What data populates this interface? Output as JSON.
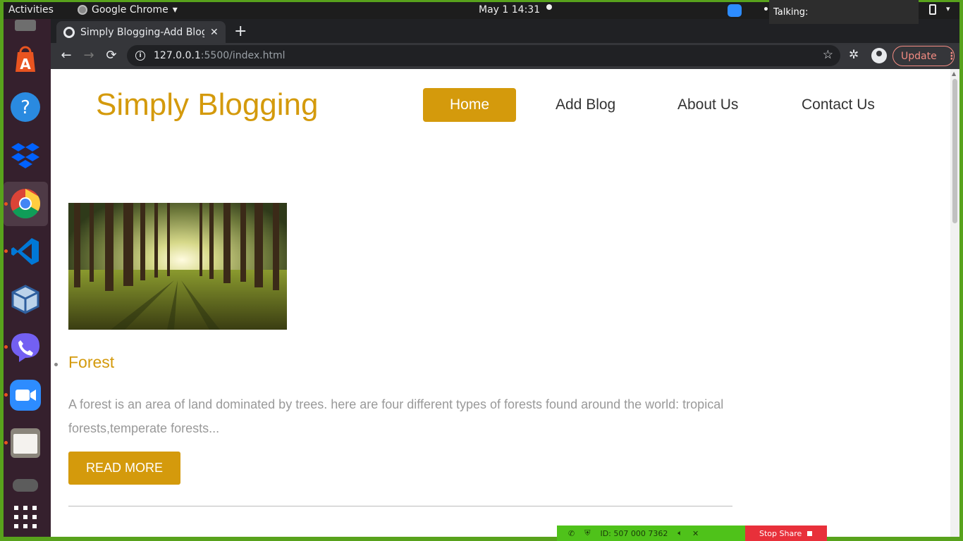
{
  "topbar": {
    "activities": "Activities",
    "app_menu": "Google Chrome",
    "app_menu_caret": "▾",
    "clock": "May 1  14:31",
    "tray_overflow": "•••",
    "talking_label": "Talking:",
    "system_caret": "▾"
  },
  "dock": {
    "items": [
      {
        "name": "files-top-partial",
        "color": "#6e6e6e"
      },
      {
        "name": "ubuntu-software",
        "color": "#e95420"
      },
      {
        "name": "help",
        "color": "#2a8ae0"
      },
      {
        "name": "dropbox",
        "color": "#0061fe"
      },
      {
        "name": "google-chrome",
        "color": "#4285f4"
      },
      {
        "name": "vscode",
        "color": "#0078d7"
      },
      {
        "name": "virtualbox",
        "color": "#2f5f9e"
      },
      {
        "name": "viber",
        "color": "#7360f2"
      },
      {
        "name": "zoom",
        "color": "#2d8cff"
      },
      {
        "name": "files",
        "color": "#b5b1a8"
      },
      {
        "name": "trash-partial",
        "color": "#6e6e6e"
      }
    ],
    "show_apps_icon": "grid-icon"
  },
  "browser": {
    "tab_title": "Simply Blogging-Add Blog",
    "tab_close": "✕",
    "new_tab": "+",
    "back": "←",
    "forward": "→",
    "reload": "⟳",
    "url_host": "127.0.0.1",
    "url_rest": ":5500/index.html",
    "star": "☆",
    "extensions": "✲",
    "update_label": "Update",
    "menu_kebab": "⋮"
  },
  "site": {
    "title": "Simply Blogging",
    "nav": {
      "home": "Home",
      "add_blog": "Add Blog",
      "about": "About Us",
      "contact": "Contact Us"
    },
    "accent": "#d49a0c"
  },
  "post": {
    "title": "Forest",
    "excerpt": "A forest is an area of land dominated by trees. here are four different types of forests found around the world: tropical forests,temperate forests...",
    "read_more": "READ MORE",
    "image_subject": "sunlit forest"
  },
  "sharebar": {
    "meeting_id": "ID: 507 000 7362",
    "stop_share": "Stop Share"
  }
}
